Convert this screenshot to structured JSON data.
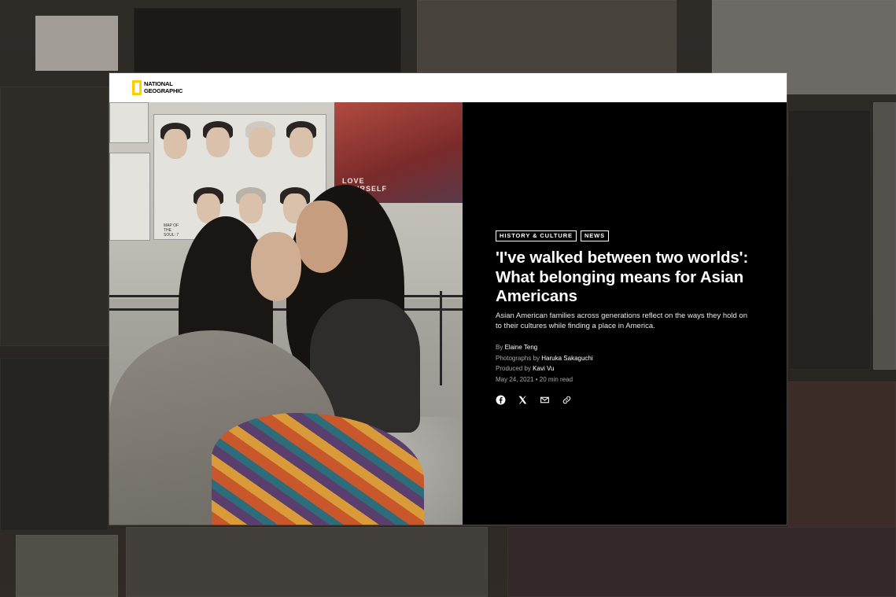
{
  "brand": {
    "name_line1": "NATIONAL",
    "name_line2": "GEOGRAPHIC",
    "accent_color": "#ffce00"
  },
  "article": {
    "tags": [
      "History & Culture",
      "News"
    ],
    "headline": "'I've walked between two worlds': What belonging means for Asian Americans",
    "dek": "Asian American families across generations reflect on the ways they hold on to their cultures while finding a place in America.",
    "credits": {
      "by_prefix": "By",
      "author": "Elaine Teng",
      "photo_prefix": "Photographs by",
      "photographer": "Haruka Sakaguchi",
      "produced_prefix": "Produced by",
      "producer": "Kavi Vu",
      "date": "May 24, 2021",
      "separator": "•",
      "read_time": "20 min read"
    },
    "poster_texts": {
      "love": "LOVE",
      "yourself": "YOURSELF",
      "map1": "MAP OF",
      "map2": "THE",
      "map3": "SOUL: 7"
    }
  },
  "share_icons": [
    "facebook-icon",
    "x-icon",
    "email-icon",
    "link-icon"
  ]
}
